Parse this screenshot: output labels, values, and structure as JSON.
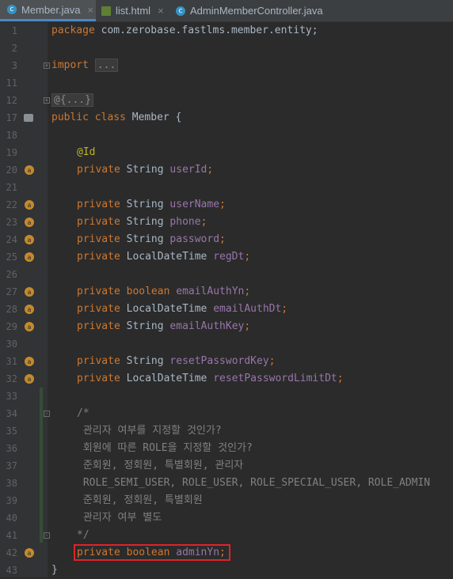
{
  "tabs": [
    {
      "label": "Member.java",
      "icon": "class-icon",
      "active": true
    },
    {
      "label": "list.html",
      "icon": "html-file-icon",
      "active": false
    },
    {
      "label": "AdminMemberController.java",
      "icon": "class-icon",
      "active": false
    }
  ],
  "tab_close_glyph": "×",
  "tab_icon_glyph": "c",
  "gutter": {
    "line_numbers": [
      "1",
      "2",
      "3",
      "11",
      "12",
      "17",
      "18",
      "19",
      "20",
      "21",
      "22",
      "23",
      "24",
      "25",
      "26",
      "27",
      "28",
      "29",
      "30",
      "31",
      "32",
      "33",
      "34",
      "35",
      "36",
      "37",
      "38",
      "39",
      "40",
      "41",
      "42",
      "43"
    ]
  },
  "code": {
    "package_kw": "package",
    "package_name": " com.zerobase.fastlms.member.entity;",
    "import_kw": "import",
    "import_fold": "...",
    "annotation_fold": "@{...}",
    "class_kw1": "public",
    "class_kw2": "class",
    "class_name": " Member {",
    "id_annotation": "@Id",
    "fields": [
      {
        "mod": "private",
        "type": " String ",
        "name": "userId",
        "end": ";"
      },
      {
        "mod": "private",
        "type": " String ",
        "name": "userName",
        "end": ";"
      },
      {
        "mod": "private",
        "type": " String ",
        "name": "phone",
        "end": ";"
      },
      {
        "mod": "private",
        "type": " String ",
        "name": "password",
        "end": ";"
      },
      {
        "mod": "private",
        "type": " LocalDateTime ",
        "name": "regDt",
        "end": ";"
      },
      {
        "mod": "private",
        "type": "boolean",
        "name": "emailAuthYn",
        "end": ";"
      },
      {
        "mod": "private",
        "type": " LocalDateTime ",
        "name": "emailAuthDt",
        "end": ";"
      },
      {
        "mod": "private",
        "type": " String ",
        "name": "emailAuthKey",
        "end": ";"
      },
      {
        "mod": "private",
        "type": " String ",
        "name": "resetPasswordKey",
        "end": ";"
      },
      {
        "mod": "private",
        "type": " LocalDateTime ",
        "name": "resetPasswordLimitDt",
        "end": ";"
      }
    ],
    "comment_open": "/*",
    "comment_lines": [
      " 관리자 여부를 지정할 것인가?",
      " 회원에 따른 ROLE을 지정할 것인가?",
      " 준회원, 정회원, 특별회원, 관리자",
      " ROLE_SEMI_USER, ROLE_USER, ROLE_SPECIAL_USER, ROLE_ADMIN",
      " 준회원, 정회원, 특별회원",
      " 관리자 여부 별도"
    ],
    "comment_close": "*/",
    "last_field": {
      "mod": "private",
      "type": "boolean",
      "name": "adminYn",
      "end": ";"
    },
    "closing_brace": "}"
  }
}
